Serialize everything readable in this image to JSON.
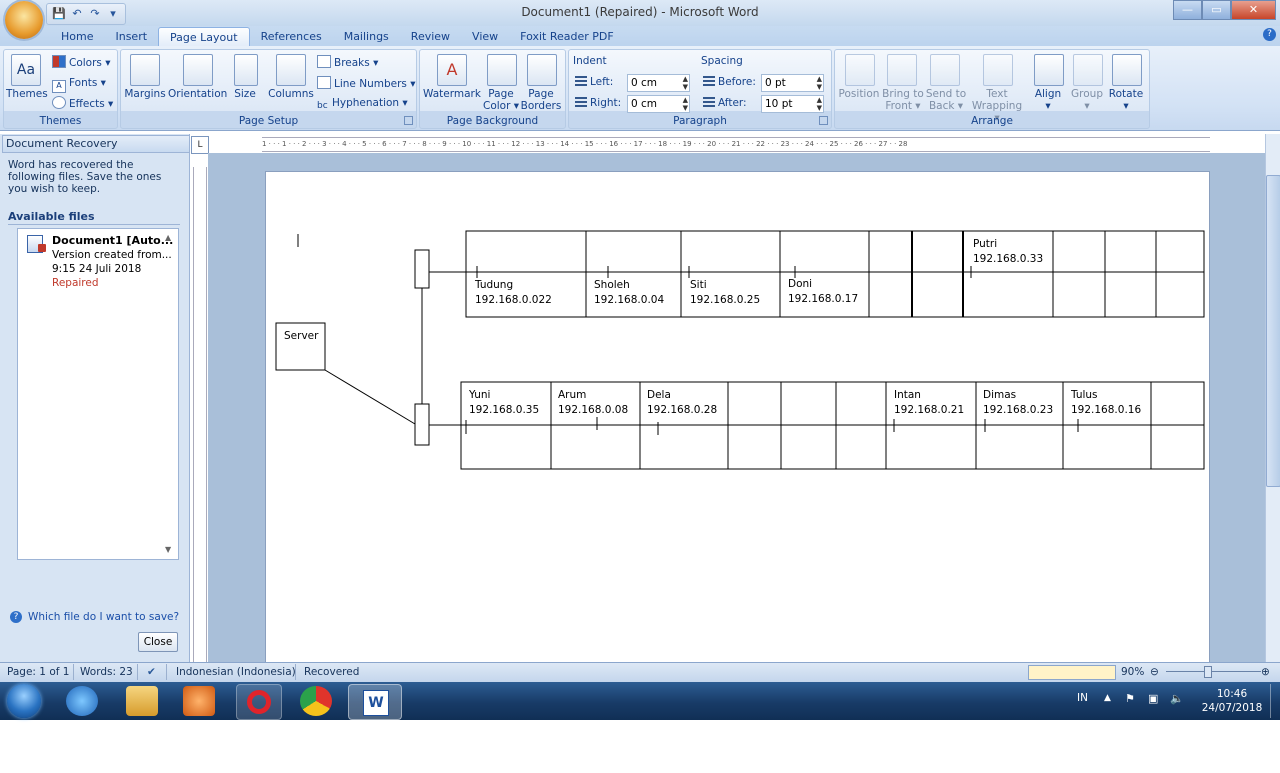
{
  "window": {
    "title": "Document1 (Repaired) - Microsoft Word",
    "min": "—",
    "max": "▭",
    "close": "✕"
  },
  "qat": {
    "save": "💾",
    "undo": "↶",
    "redo": "↷",
    "more": "▾"
  },
  "tabs": [
    "Home",
    "Insert",
    "Page Layout",
    "References",
    "Mailings",
    "Review",
    "View",
    "Foxit Reader PDF"
  ],
  "ribbon": {
    "themes": {
      "label": "Themes",
      "themes_btn": "Themes",
      "colors": "Colors",
      "fonts": "Fonts",
      "effects": "Effects"
    },
    "page_setup": {
      "label": "Page Setup",
      "margins": "Margins",
      "orientation": "Orientation",
      "size": "Size",
      "columns": "Columns",
      "breaks": "Breaks",
      "line_numbers": "Line Numbers",
      "hyphenation": "Hyphenation"
    },
    "page_background": {
      "label": "Page Background",
      "watermark": "Watermark",
      "page_color_1": "Page",
      "page_color_2": "Color",
      "page_borders_1": "Page",
      "page_borders_2": "Borders"
    },
    "paragraph": {
      "label": "Paragraph",
      "indent": "Indent",
      "left_label": "Left:",
      "left_value": "0 cm",
      "right_label": "Right:",
      "right_value": "0 cm",
      "spacing": "Spacing",
      "before_label": "Before:",
      "before_value": "0 pt",
      "after_label": "After:",
      "after_value": "10 pt"
    },
    "arrange": {
      "label": "Arrange",
      "position": "Position",
      "bring_1": "Bring to",
      "bring_2": "Front",
      "send_1": "Send to",
      "send_2": "Back",
      "wrap_1": "Text",
      "wrap_2": "Wrapping",
      "align": "Align",
      "group": "Group",
      "rotate": "Rotate"
    }
  },
  "recovery": {
    "title": "Document Recovery",
    "description": "Word has recovered the following files.  Save the ones you wish to keep.",
    "available": "Available files",
    "file": {
      "name": "Document1  [Auto...",
      "version": "Version created from...",
      "time": "9:15 24 Juli 2018",
      "status": "Repaired"
    },
    "help": "Which file do I want to save?",
    "close": "Close"
  },
  "document": {
    "server": "Server",
    "top_row": [
      {
        "name": "Tudung",
        "ip": "192.168.0.022"
      },
      {
        "name": "Sholeh",
        "ip": "192.168.0.04"
      },
      {
        "name": "Siti",
        "ip": "192.168.0.25"
      },
      {
        "name": "Doni",
        "ip": "192.168.0.17"
      },
      {
        "name": "Putri",
        "ip": "192.168.0.33"
      }
    ],
    "bottom_row": [
      {
        "name": "Yuni",
        "ip": "192.168.0.35"
      },
      {
        "name": "Arum",
        "ip": "192.168.0.08"
      },
      {
        "name": "Dela",
        "ip": "192.168.0.28"
      },
      {
        "name": "Intan",
        "ip": "192.168.0.21"
      },
      {
        "name": "Dimas",
        "ip": "192.168.0.23"
      },
      {
        "name": "Tulus",
        "ip": "192.168.0.16"
      }
    ]
  },
  "ruler": "1 · · · 1 · · · 2 · · · 3 · · · 4 · · · 5 · · · 6 · · · 7 · · · 8 · · · 9 · · · 10 · · · 11 · · · 12 · · · 13 · · · 14 · · · 15 · · · 16 · · · 17 · · · 18 · · · 19 · · · 20 · · · 21 · · · 22 · · · 23 · · · 24 · · · 25 · · · 26 · · · 27 · · 28",
  "status": {
    "page": "Page: 1 of 1",
    "words": "Words: 23",
    "language": "Indonesian (Indonesia)",
    "recovered": "Recovered",
    "zoom": "90%"
  },
  "taskbar": {
    "lang": "IN",
    "time": "10:46",
    "date": "24/07/2018"
  }
}
